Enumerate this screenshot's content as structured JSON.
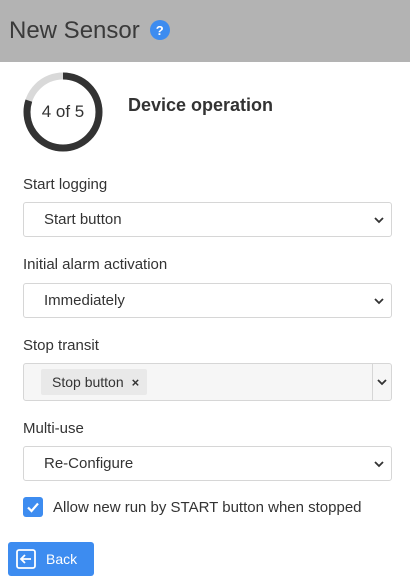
{
  "header": {
    "title": "New Sensor",
    "help_icon": "?",
    "background": "#b3b3b3"
  },
  "step": {
    "label": "4 of 5",
    "current": 4,
    "total": 5,
    "title": "Device operation"
  },
  "fields": {
    "start_logging": {
      "label": "Start logging",
      "value": "Start button"
    },
    "initial_alarm": {
      "label": "Initial alarm activation",
      "value": "Immediately"
    },
    "stop_transit": {
      "label": "Stop transit",
      "tags": [
        "Stop button"
      ],
      "tag_remove": "×"
    },
    "multi_use": {
      "label": "Multi-use",
      "value": "Re-Configure"
    }
  },
  "checkbox": {
    "label": "Allow new run by START button when stopped",
    "checked": true
  },
  "back_button": {
    "label": "Back",
    "icon": "arrow-left-icon"
  },
  "colors": {
    "accent": "#3d8cf0",
    "ring_progress": "#333333",
    "ring_track": "#d9d9d9"
  }
}
